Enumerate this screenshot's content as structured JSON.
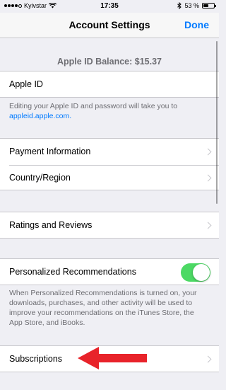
{
  "status_bar": {
    "carrier": "Kyivstar",
    "time": "17:35",
    "battery_percent": "53 %",
    "battery_level": 0.53
  },
  "nav": {
    "title": "Account Settings",
    "done_label": "Done"
  },
  "balance": "Apple ID Balance: $15.37",
  "apple_id": {
    "label": "Apple ID",
    "footnote_text": "Editing your Apple ID and password will take you to",
    "footnote_link": "appleid.apple.com."
  },
  "group2": {
    "payment_label": "Payment Information",
    "country_label": "Country/Region"
  },
  "group3": {
    "ratings_label": "Ratings and Reviews"
  },
  "recommendations": {
    "label": "Personalized Recommendations",
    "enabled": true,
    "footnote": "When Personalized Recommendations is turned on, your downloads, purchases, and other activity will be used to improve your recommendations on the iTunes Store, the App Store, and iBooks."
  },
  "subscriptions": {
    "label": "Subscriptions"
  },
  "colors": {
    "accent": "#007aff",
    "toggle_on": "#4cd964",
    "arrow": "#e8232a",
    "background": "#efeff4"
  }
}
